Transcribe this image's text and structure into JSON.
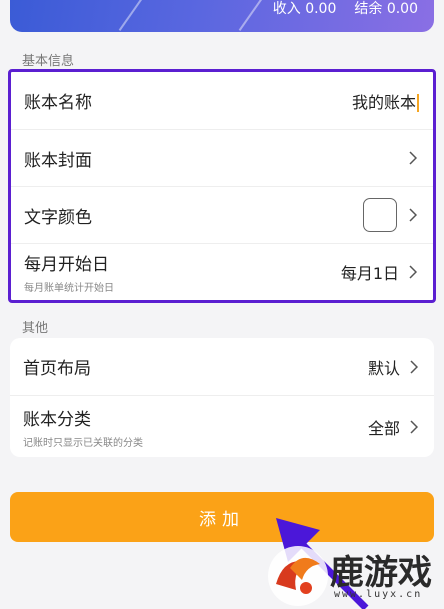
{
  "preview": {
    "income_label": "收入 0.00",
    "balance_label": "结余 0.00"
  },
  "basic_section": {
    "label": "基本信息",
    "rows": {
      "name": {
        "title": "账本名称",
        "value": "我的账本"
      },
      "cover": {
        "title": "账本封面"
      },
      "text_color": {
        "title": "文字颜色",
        "swatch_color": "#ffffff"
      },
      "start_day": {
        "title": "每月开始日",
        "subtitle": "每月账单统计开始日",
        "value": "每月1日"
      }
    }
  },
  "other_section": {
    "label": "其他",
    "rows": {
      "layout": {
        "title": "首页布局",
        "value": "默认"
      },
      "category": {
        "title": "账本分类",
        "subtitle": "记账时只显示已关联的分类",
        "value": "全部"
      }
    }
  },
  "add_button": {
    "label": "添加"
  },
  "watermark": {
    "text": "鹿游戏",
    "url": "www.luyx.cn"
  },
  "colors": {
    "accent": "#fba217",
    "highlight_border": "#5b1fd1",
    "card_gradient_start": "#3a5bd6",
    "card_gradient_end": "#8a6fe4"
  }
}
